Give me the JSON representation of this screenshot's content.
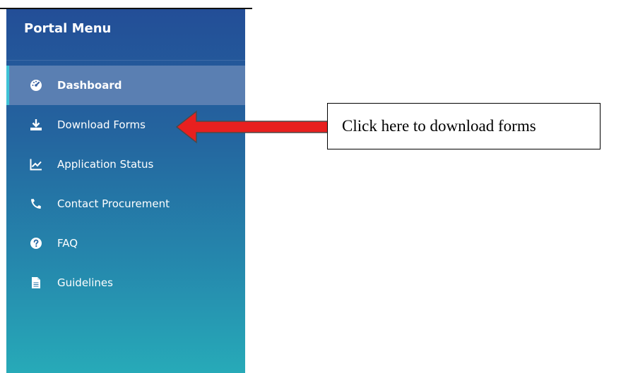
{
  "sidebar": {
    "title": "Portal Menu",
    "items": [
      {
        "label": "Dashboard",
        "icon": "dashboard-icon",
        "active": true
      },
      {
        "label": "Download Forms",
        "icon": "download-icon",
        "active": false
      },
      {
        "label": "Application Status",
        "icon": "line-chart-icon",
        "active": false
      },
      {
        "label": "Contact Procurement",
        "icon": "phone-icon",
        "active": false
      },
      {
        "label": "FAQ",
        "icon": "question-circle-icon",
        "active": false
      },
      {
        "label": "Guidelines",
        "icon": "document-icon",
        "active": false
      }
    ]
  },
  "annotation": {
    "text": "Click here to download forms",
    "arrow_color": "#e8201f"
  },
  "colors": {
    "sidebar_top": "#234e97",
    "sidebar_bottom": "#27aab8",
    "active_item": "#5a7fb2",
    "active_marker": "#3ec3d6"
  }
}
